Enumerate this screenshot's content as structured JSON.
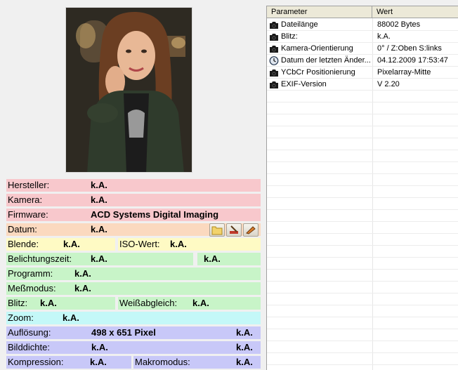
{
  "info": {
    "hersteller": {
      "label": "Hersteller:",
      "value": "k.A."
    },
    "kamera": {
      "label": "Kamera:",
      "value": "k.A."
    },
    "firmware": {
      "label": "Firmware:",
      "value": "ACD Systems Digital Imaging"
    },
    "datum": {
      "label": "Datum:",
      "value": "k.A."
    },
    "blende": {
      "label": "Blende:",
      "value": "k.A."
    },
    "iso": {
      "label": "ISO-Wert:",
      "value": "k.A."
    },
    "belichtungszeit": {
      "label": "Belichtungszeit:",
      "value": "k.A.",
      "value2": "k.A."
    },
    "programm": {
      "label": "Programm:",
      "value": "k.A."
    },
    "messmodus": {
      "label": "Meßmodus:",
      "value": "k.A."
    },
    "blitz": {
      "label": "Blitz:",
      "value": "k.A."
    },
    "weissabgleich": {
      "label": "Weißabgleich:",
      "value": "k.A."
    },
    "zoom": {
      "label": "Zoom:",
      "value": "k.A."
    },
    "aufloesung": {
      "label": "Auflösung:",
      "value": "498 x 651 Pixel",
      "value2": "k.A."
    },
    "bilddichte": {
      "label": "Bilddichte:",
      "value": "k.A.",
      "value2": "k.A."
    },
    "kompression": {
      "label": "Kompression:",
      "value": "k.A."
    },
    "makromodus": {
      "label": "Makromodus:",
      "value": "k.A."
    }
  },
  "toolbar": {
    "icons": [
      "folder-icon",
      "edit-icon",
      "pencil-icon"
    ]
  },
  "table": {
    "headers": {
      "param": "Parameter",
      "wert": "Wert"
    },
    "rows": [
      {
        "icon": "camera-icon",
        "param": "Dateilänge",
        "wert": "88002 Bytes"
      },
      {
        "icon": "camera-icon",
        "param": "Blitz:",
        "wert": "k.A."
      },
      {
        "icon": "camera-icon",
        "param": "Kamera-Orientierung",
        "wert": "0° / Z:Oben S:links"
      },
      {
        "icon": "clock-icon",
        "param": "Datum der letzten Änder...",
        "wert": "04.12.2009 17:53:47"
      },
      {
        "icon": "camera-icon",
        "param": "YCbCr Positionierung",
        "wert": "Pixelarray-Mitte"
      },
      {
        "icon": "camera-icon",
        "param": "EXIF-Version",
        "wert": "V 2.20"
      }
    ]
  },
  "colors": {
    "pink": "#f8c8cc",
    "peach": "#fbd9bf",
    "yellow": "#fefac4",
    "green": "#c8f4c8",
    "cyan": "#c4f8f8",
    "violet": "#c8c8f8"
  }
}
